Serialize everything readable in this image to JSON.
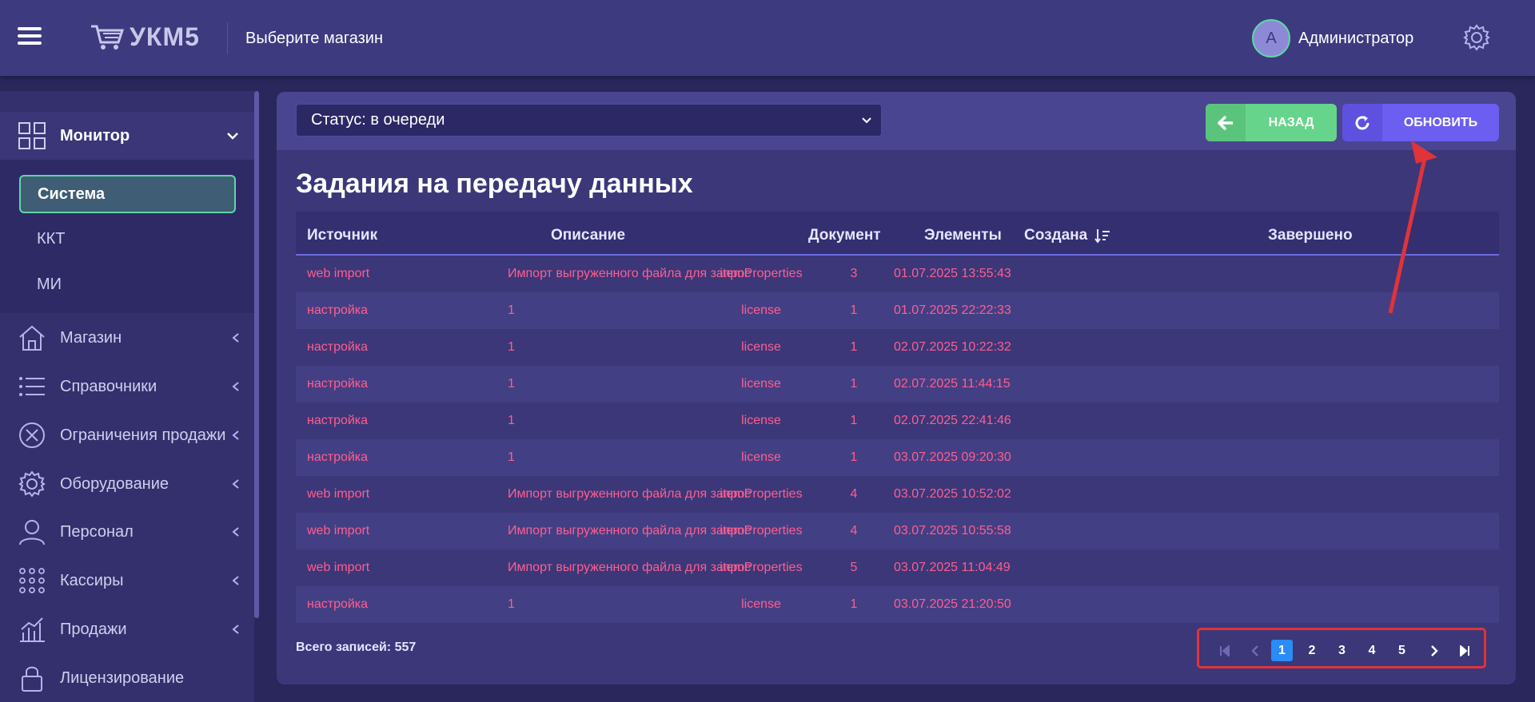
{
  "header": {
    "logo": "УКМ5",
    "store_select": "Выберите магазин",
    "user_initial": "A",
    "user_name": "Администратор"
  },
  "sidebar": {
    "monitor": "Монитор",
    "sub": [
      "Система",
      "ККТ",
      "МИ"
    ],
    "items": [
      "Магазин",
      "Справочники",
      "Ограничения продажи",
      "Оборудование",
      "Персонал",
      "Кассиры",
      "Продажи",
      "Лицензирование"
    ]
  },
  "toolbar": {
    "status": "Статус: в очереди",
    "back": "НАЗАД",
    "refresh": "ОБНОВИТЬ"
  },
  "page_title": "Задания на передачу данных",
  "table": {
    "headers": [
      "Источник",
      "Описание",
      "Документ",
      "Элементы",
      "Создана",
      "Завершено"
    ],
    "rows": [
      [
        "web import",
        "Импорт выгруженного файла для запрос",
        "itemProperties",
        "3",
        "01.07.2025 13:55:43",
        ""
      ],
      [
        "настройка",
        "1",
        "license",
        "1",
        "01.07.2025 22:22:33",
        ""
      ],
      [
        "настройка",
        "1",
        "license",
        "1",
        "02.07.2025 10:22:32",
        ""
      ],
      [
        "настройка",
        "1",
        "license",
        "1",
        "02.07.2025 11:44:15",
        ""
      ],
      [
        "настройка",
        "1",
        "license",
        "1",
        "02.07.2025 22:41:46",
        ""
      ],
      [
        "настройка",
        "1",
        "license",
        "1",
        "03.07.2025 09:20:30",
        ""
      ],
      [
        "web import",
        "Импорт выгруженного файла для запрос",
        "itemProperties",
        "4",
        "03.07.2025 10:52:02",
        ""
      ],
      [
        "web import",
        "Импорт выгруженного файла для запрос",
        "itemProperties",
        "4",
        "03.07.2025 10:55:58",
        ""
      ],
      [
        "web import",
        "Импорт выгруженного файла для запрос",
        "itemProperties",
        "5",
        "03.07.2025 11:04:49",
        ""
      ],
      [
        "настройка",
        "1",
        "license",
        "1",
        "03.07.2025 21:20:50",
        ""
      ]
    ]
  },
  "total": "Всего записей: 557",
  "pagination": {
    "pages": [
      "1",
      "2",
      "3",
      "4",
      "5"
    ],
    "current": "1"
  },
  "colors": {
    "accent_green": "#66d48a",
    "accent_purple": "#6b5ef0",
    "row_text": "#ff5e8e",
    "active_page": "#2a8cf5",
    "annotation": "#e0333a"
  }
}
